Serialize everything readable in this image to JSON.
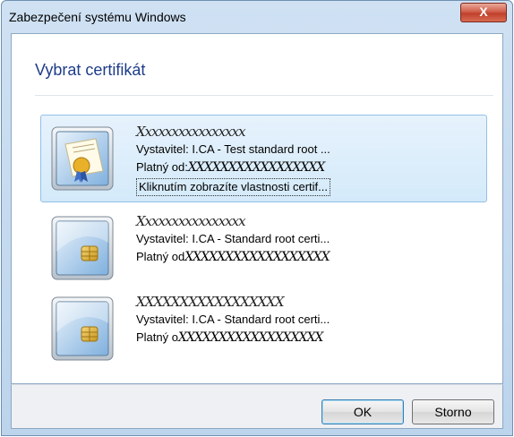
{
  "window": {
    "title": "Zabezpečení systému Windows",
    "close_label": "X"
  },
  "dialog": {
    "heading": "Vybrat certifikát",
    "certificates": [
      {
        "name": "Xxxxxxxxxxxxxxxx",
        "issuer": "Vystavitel: I.CA - Test standard root ...",
        "valid_label": "Platný od:",
        "valid_value": "XXXXXXXXXXXXXXXXX",
        "details_link": "Kliknutím zobrazíte vlastnosti certif...",
        "icon": "certificate-seal-icon",
        "selected": true
      },
      {
        "name": "Xxxxxxxxxxxxxxxx",
        "issuer": "Vystavitel: I.CA - Standard root certi...",
        "valid_label": "Platný od",
        "valid_value": "XXXXXXXXXXXXXXXXXX",
        "icon": "smartcard-chip-icon",
        "selected": false
      },
      {
        "name": "XXXXXXXXXXXXXXXXX",
        "issuer": "Vystavitel: I.CA - Standard root certi...",
        "valid_label": "Platný o",
        "valid_value": "XXXXXXXXXXXXXXXXXX",
        "icon": "smartcard-chip-icon",
        "selected": false
      }
    ]
  },
  "buttons": {
    "ok": "OK",
    "cancel": "Storno"
  },
  "colors": {
    "heading": "#1e3d8a",
    "selection": "#d4eafa",
    "selection_border": "#93c0e6"
  }
}
